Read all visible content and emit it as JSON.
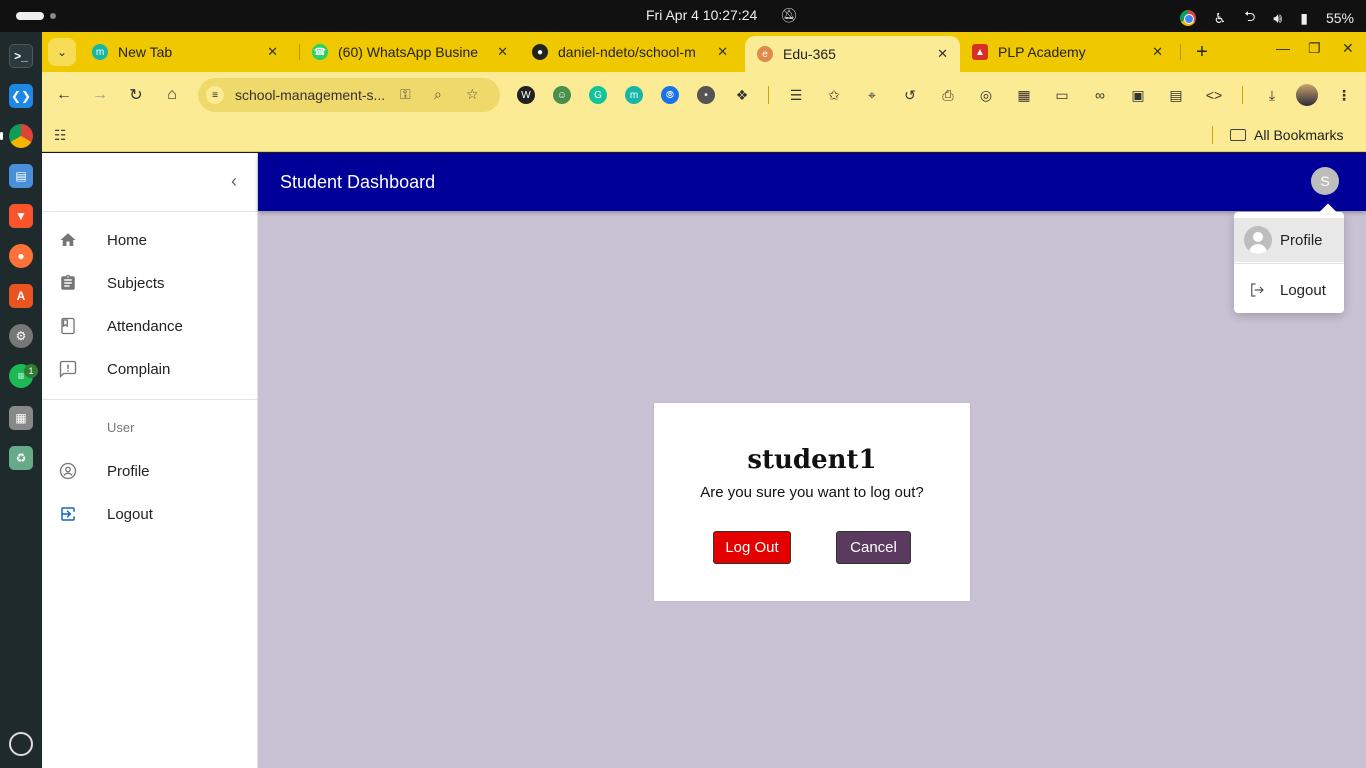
{
  "system": {
    "clock": "Fri Apr 4  10:27:24",
    "battery": "55%"
  },
  "browser": {
    "tabs": [
      {
        "title": "New Tab",
        "favicon": "m-icon",
        "color": "#17b6a6"
      },
      {
        "title": "(60) WhatsApp Busine",
        "favicon": "whatsapp-icon",
        "color": "#25d366"
      },
      {
        "title": "daniel-ndeto/school-m",
        "favicon": "github-icon",
        "color": "#222222"
      },
      {
        "title": "Edu-365",
        "favicon": "edu-icon",
        "color": "#e08a4a"
      },
      {
        "title": "PLP Academy",
        "favicon": "plp-icon",
        "color": "#d93025"
      }
    ],
    "url": "school-management-s...",
    "bookmarks_all": "All Bookmarks"
  },
  "app": {
    "header_title": "Student Dashboard",
    "avatar_initial": "S",
    "sidebar": {
      "items": [
        {
          "label": "Home",
          "icon": "home-icon"
        },
        {
          "label": "Subjects",
          "icon": "clipboard-icon"
        },
        {
          "label": "Attendance",
          "icon": "bookmark-icon"
        },
        {
          "label": "Complain",
          "icon": "feedback-icon"
        }
      ],
      "section_label": "User",
      "user_items": [
        {
          "label": "Profile",
          "icon": "account-circle-icon"
        },
        {
          "label": "Logout",
          "icon": "logout-icon"
        }
      ]
    },
    "account_menu": {
      "profile_label": "Profile",
      "logout_label": "Logout"
    },
    "logout_dialog": {
      "username": "student1",
      "question": "Are you sure you want to log out?",
      "confirm_label": "Log Out",
      "cancel_label": "Cancel"
    },
    "colors": {
      "appbar": "#000098",
      "page_background": "#c9c2d4",
      "logout_button": "#e50000",
      "cancel_button": "#5a3a5f",
      "browser_theme": "#f0c800"
    }
  }
}
